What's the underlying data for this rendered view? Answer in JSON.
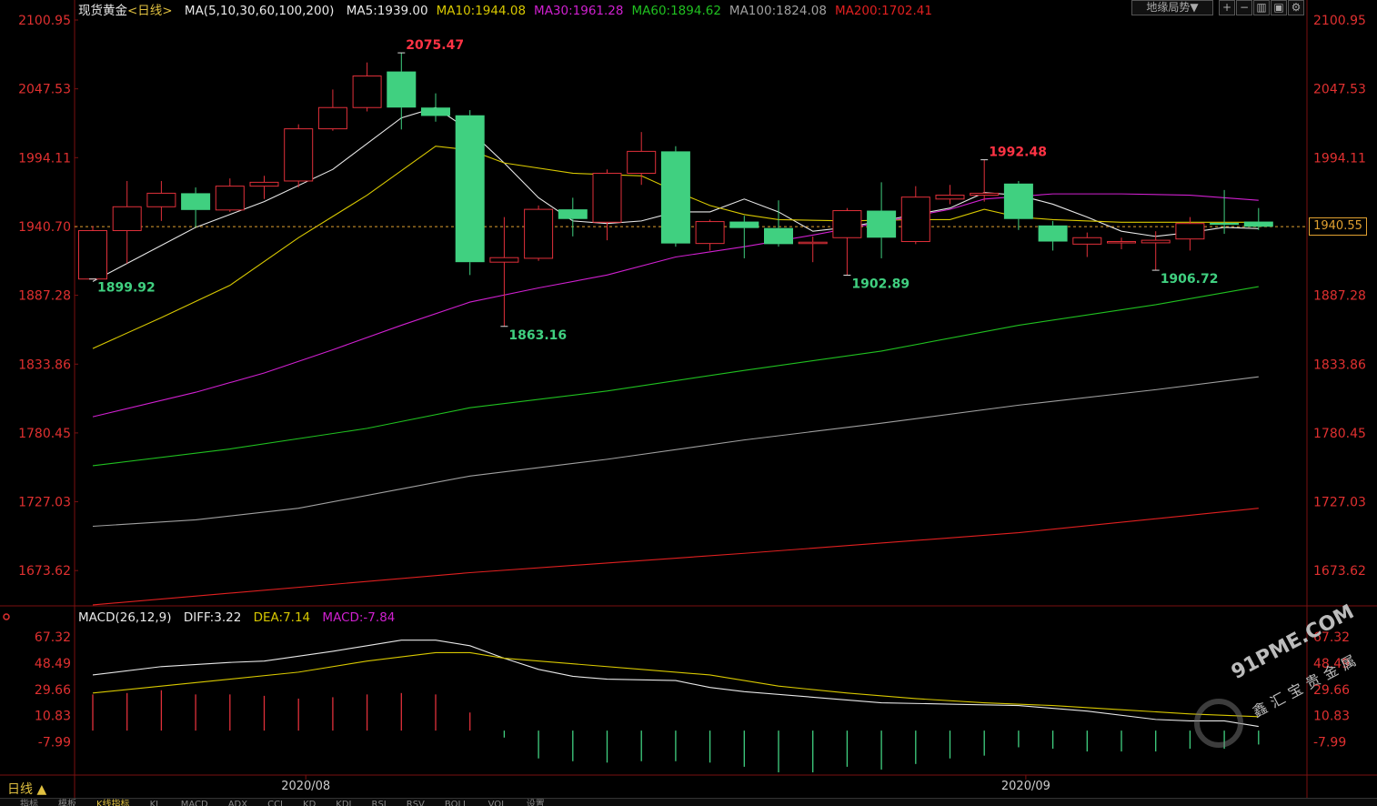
{
  "header": {
    "instrument": "现货黄金",
    "period_tag": "<日线>",
    "ma_params": "MA(5,10,30,60,100,200)",
    "ma_values": [
      {
        "name": "MA5",
        "text": "MA5:1939.00",
        "color": "#e8e8e8"
      },
      {
        "name": "MA10",
        "text": "MA10:1944.08",
        "color": "#d8c800"
      },
      {
        "name": "MA30",
        "text": "MA30:1961.28",
        "color": "#d020d0"
      },
      {
        "name": "MA60",
        "text": "MA60:1894.62",
        "color": "#20c020"
      },
      {
        "name": "MA100",
        "text": "MA100:1824.08",
        "color": "#a0a0a0"
      },
      {
        "name": "MA200",
        "text": "MA200:1702.41",
        "color": "#e02020"
      }
    ],
    "dropdown_label": "地缘局势▼"
  },
  "colors": {
    "up": "#e0303a",
    "down": "#40d080",
    "axis_text": "#e03030",
    "current_line": "#e0a030"
  },
  "chart_data": [
    {
      "type": "candlestick",
      "title": "现货黄金<日线>",
      "ylim": [
        1646.93,
        2100.95
      ],
      "y_ticks": [
        "2100.95",
        "2047.53",
        "1994.11",
        "1940.70",
        "1887.28",
        "1833.86",
        "1780.45",
        "1727.03",
        "1673.62"
      ],
      "x_labels": [
        {
          "text": "2020/08",
          "index": 6
        },
        {
          "text": "2020/09",
          "index": 27
        }
      ],
      "current_price": "1940.55",
      "annotations": [
        {
          "text": "2075.47",
          "index": 9,
          "value": 2075.47,
          "kind": "high"
        },
        {
          "text": "1899.92",
          "index": 0,
          "value": 1899.92,
          "kind": "low"
        },
        {
          "text": "1863.16",
          "index": 12,
          "value": 1863.16,
          "kind": "low"
        },
        {
          "text": "1992.48",
          "index": 26,
          "value": 1992.48,
          "kind": "high"
        },
        {
          "text": "1902.89",
          "index": 22,
          "value": 1902.89,
          "kind": "low"
        },
        {
          "text": "1906.72",
          "index": 31,
          "value": 1906.72,
          "kind": "low"
        }
      ],
      "candles": [
        {
          "o": 1899.92,
          "c": 1937.5,
          "h": 1941.0,
          "l": 1899.92
        },
        {
          "o": 1937.5,
          "c": 1956.0,
          "h": 1976.0,
          "l": 1912.0
        },
        {
          "o": 1956.0,
          "c": 1966.5,
          "h": 1976.0,
          "l": 1945.0
        },
        {
          "o": 1966.5,
          "c": 1953.5,
          "h": 1971.0,
          "l": 1940.0
        },
        {
          "o": 1953.5,
          "c": 1972.0,
          "h": 1978.0,
          "l": 1952.0
        },
        {
          "o": 1972.0,
          "c": 1975.0,
          "h": 1980.0,
          "l": 1962.0
        },
        {
          "o": 1976.0,
          "c": 2016.5,
          "h": 2020.0,
          "l": 1971.0
        },
        {
          "o": 2016.5,
          "c": 2033.0,
          "h": 2047.0,
          "l": 2015.0
        },
        {
          "o": 2033.0,
          "c": 2057.5,
          "h": 2068.0,
          "l": 2030.0
        },
        {
          "o": 2061.0,
          "c": 2033.0,
          "h": 2075.47,
          "l": 2016.0
        },
        {
          "o": 2033.0,
          "c": 2026.5,
          "h": 2044.0,
          "l": 2022.0
        },
        {
          "o": 2027.0,
          "c": 1913.0,
          "h": 2031.0,
          "l": 1903.0
        },
        {
          "o": 1913.0,
          "c": 1916.5,
          "h": 1948.0,
          "l": 1863.16
        },
        {
          "o": 1916.0,
          "c": 1954.0,
          "h": 1957.0,
          "l": 1914.0
        },
        {
          "o": 1954.0,
          "c": 1946.5,
          "h": 1963.0,
          "l": 1933.0
        },
        {
          "o": 1944.0,
          "c": 1982.0,
          "h": 1985.0,
          "l": 1930.0
        },
        {
          "o": 1982.0,
          "c": 1999.0,
          "h": 2014.0,
          "l": 1973.0
        },
        {
          "o": 1999.0,
          "c": 1927.5,
          "h": 2003.0,
          "l": 1925.0
        },
        {
          "o": 1927.5,
          "c": 1944.5,
          "h": 1946.0,
          "l": 1922.0
        },
        {
          "o": 1944.5,
          "c": 1939.5,
          "h": 1949.0,
          "l": 1916.0
        },
        {
          "o": 1939.5,
          "c": 1927.0,
          "h": 1961.0,
          "l": 1925.0
        },
        {
          "o": 1928.0,
          "c": 1928.5,
          "h": 1933.0,
          "l": 1913.0
        },
        {
          "o": 1932.0,
          "c": 1953.0,
          "h": 1955.0,
          "l": 1902.89
        },
        {
          "o": 1953.0,
          "c": 1932.0,
          "h": 1975.0,
          "l": 1916.0
        },
        {
          "o": 1929.0,
          "c": 1963.5,
          "h": 1972.0,
          "l": 1927.0
        },
        {
          "o": 1962.0,
          "c": 1965.0,
          "h": 1973.0,
          "l": 1958.0
        },
        {
          "o": 1965.0,
          "c": 1966.5,
          "h": 1992.48,
          "l": 1960.0
        },
        {
          "o": 1974.0,
          "c": 1946.5,
          "h": 1976.0,
          "l": 1938.0
        },
        {
          "o": 1941.5,
          "c": 1929.0,
          "h": 1945.0,
          "l": 1922.0
        },
        {
          "o": 1927.0,
          "c": 1932.0,
          "h": 1936.0,
          "l": 1917.0
        },
        {
          "o": 1928.5,
          "c": 1929.0,
          "h": 1932.0,
          "l": 1923.0
        },
        {
          "o": 1928.0,
          "c": 1930.0,
          "h": 1937.0,
          "l": 1906.72
        },
        {
          "o": 1931.0,
          "c": 1943.0,
          "h": 1948.0,
          "l": 1922.0
        },
        {
          "o": 1943.5,
          "c": 1942.0,
          "h": 1969.0,
          "l": 1935.0
        },
        {
          "o": 1944.5,
          "c": 1940.5,
          "h": 1955.0,
          "l": 1938.0
        }
      ],
      "ma_series": [
        {
          "name": "MA5",
          "color": "#e8e8e8",
          "values": [
            [
              0,
              1898
            ],
            [
              3,
              1940
            ],
            [
              5,
              1960
            ],
            [
              7,
              1985
            ],
            [
              9,
              2025
            ],
            [
              10,
              2033
            ],
            [
              11,
              2015
            ],
            [
              12,
              1990
            ],
            [
              13,
              1963
            ],
            [
              14,
              1945
            ],
            [
              15,
              1943
            ],
            [
              16,
              1945
            ],
            [
              17,
              1952
            ],
            [
              18,
              1952
            ],
            [
              19,
              1962
            ],
            [
              20,
              1952
            ],
            [
              21,
              1937
            ],
            [
              22,
              1940
            ],
            [
              23,
              1945
            ],
            [
              24,
              1950
            ],
            [
              25,
              1955
            ],
            [
              26,
              1967
            ],
            [
              27,
              1965
            ],
            [
              28,
              1958
            ],
            [
              29,
              1948
            ],
            [
              30,
              1937
            ],
            [
              31,
              1933
            ],
            [
              32,
              1936
            ],
            [
              33,
              1940
            ],
            [
              34,
              1939
            ]
          ]
        },
        {
          "name": "MA10",
          "color": "#d8c800",
          "values": [
            [
              0,
              1846
            ],
            [
              2,
              1870
            ],
            [
              4,
              1895
            ],
            [
              6,
              1932
            ],
            [
              8,
              1965
            ],
            [
              10,
              2003
            ],
            [
              11,
              2000
            ],
            [
              12,
              1990
            ],
            [
              14,
              1982
            ],
            [
              16,
              1980
            ],
            [
              17,
              1968
            ],
            [
              18,
              1957
            ],
            [
              19,
              1950
            ],
            [
              20,
              1946
            ],
            [
              22,
              1945
            ],
            [
              24,
              1946
            ],
            [
              25,
              1946
            ],
            [
              26,
              1954
            ],
            [
              27,
              1948
            ],
            [
              28,
              1946
            ],
            [
              30,
              1944
            ],
            [
              32,
              1944
            ],
            [
              34,
              1944
            ]
          ]
        },
        {
          "name": "MA30",
          "color": "#d020d0",
          "values": [
            [
              0,
              1793
            ],
            [
              3,
              1812
            ],
            [
              5,
              1827
            ],
            [
              7,
              1845
            ],
            [
              9,
              1864
            ],
            [
              11,
              1882
            ],
            [
              13,
              1893
            ],
            [
              15,
              1903
            ],
            [
              17,
              1917
            ],
            [
              19,
              1925
            ],
            [
              21,
              1934
            ],
            [
              23,
              1944
            ],
            [
              25,
              1954
            ],
            [
              26,
              1962
            ],
            [
              28,
              1966
            ],
            [
              30,
              1966
            ],
            [
              32,
              1965
            ],
            [
              34,
              1961
            ]
          ]
        },
        {
          "name": "MA60",
          "color": "#20c020",
          "values": [
            [
              0,
              1755
            ],
            [
              4,
              1768
            ],
            [
              8,
              1784
            ],
            [
              11,
              1800
            ],
            [
              15,
              1813
            ],
            [
              19,
              1829
            ],
            [
              23,
              1844
            ],
            [
              27,
              1864
            ],
            [
              31,
              1880
            ],
            [
              34,
              1894
            ]
          ]
        },
        {
          "name": "MA100",
          "color": "#a0a0a0",
          "values": [
            [
              0,
              1708
            ],
            [
              3,
              1713
            ],
            [
              6,
              1722
            ],
            [
              9,
              1737
            ],
            [
              11,
              1747
            ],
            [
              15,
              1760
            ],
            [
              19,
              1775
            ],
            [
              23,
              1788
            ],
            [
              27,
              1802
            ],
            [
              31,
              1814
            ],
            [
              34,
              1824
            ]
          ]
        },
        {
          "name": "MA200",
          "color": "#e02020",
          "values": [
            [
              0,
              1647
            ],
            [
              11,
              1672
            ],
            [
              19,
              1687
            ],
            [
              27,
              1703
            ],
            [
              34,
              1722
            ]
          ]
        }
      ]
    },
    {
      "type": "macd",
      "title": "MACD(26,12,9)",
      "legend": [
        {
          "text": "DIFF:3.22",
          "color": "#e8e8e8"
        },
        {
          "text": "DEA:7.14",
          "color": "#d8c800"
        },
        {
          "text": "MACD:-7.84",
          "color": "#d020d0"
        }
      ],
      "ylim": [
        -13,
        72
      ],
      "y_ticks": [
        "67.32",
        "48.49",
        "29.66",
        "10.83",
        "-7.99"
      ],
      "diff": [
        [
          0,
          40
        ],
        [
          2,
          46
        ],
        [
          4,
          49
        ],
        [
          5,
          50
        ],
        [
          7,
          57
        ],
        [
          8,
          61
        ],
        [
          9,
          65
        ],
        [
          10,
          65
        ],
        [
          11,
          61
        ],
        [
          12,
          52
        ],
        [
          13,
          44
        ],
        [
          14,
          39
        ],
        [
          15,
          37
        ],
        [
          17,
          36
        ],
        [
          18,
          31
        ],
        [
          19,
          28
        ],
        [
          21,
          24
        ],
        [
          23,
          20
        ],
        [
          25,
          19
        ],
        [
          27,
          18
        ],
        [
          29,
          14
        ],
        [
          31,
          8
        ],
        [
          32,
          7
        ],
        [
          33,
          7
        ],
        [
          34,
          3
        ]
      ],
      "dea": [
        [
          0,
          27
        ],
        [
          2,
          32
        ],
        [
          4,
          37
        ],
        [
          6,
          42
        ],
        [
          8,
          50
        ],
        [
          10,
          56
        ],
        [
          11,
          56
        ],
        [
          12,
          52
        ],
        [
          14,
          48
        ],
        [
          16,
          44
        ],
        [
          18,
          40
        ],
        [
          20,
          32
        ],
        [
          22,
          27
        ],
        [
          24,
          23
        ],
        [
          26,
          20
        ],
        [
          28,
          18
        ],
        [
          30,
          15
        ],
        [
          32,
          12
        ],
        [
          34,
          10
        ]
      ],
      "hist": [
        26,
        27,
        29,
        26,
        26,
        25,
        23,
        24,
        26,
        27,
        26,
        13,
        -5,
        -20,
        -22,
        -23,
        -22,
        -22,
        -23,
        -26,
        -30,
        -30,
        -26,
        -28,
        -24,
        -20,
        -18,
        -12,
        -13,
        -15,
        -15,
        -15,
        -13,
        -13,
        -10
      ]
    }
  ],
  "watermark": {
    "main": "91PME.COM",
    "sub": "鑫汇宝贵金属"
  },
  "footer": {
    "period_label": "日线",
    "tabs": [
      "指标",
      "模板",
      "K线指标",
      "KL",
      "MACD",
      "ADX",
      "CCI",
      "KD",
      "KDJ",
      "RSI",
      "RSV",
      "BOLL",
      "VOL",
      "设置"
    ]
  }
}
